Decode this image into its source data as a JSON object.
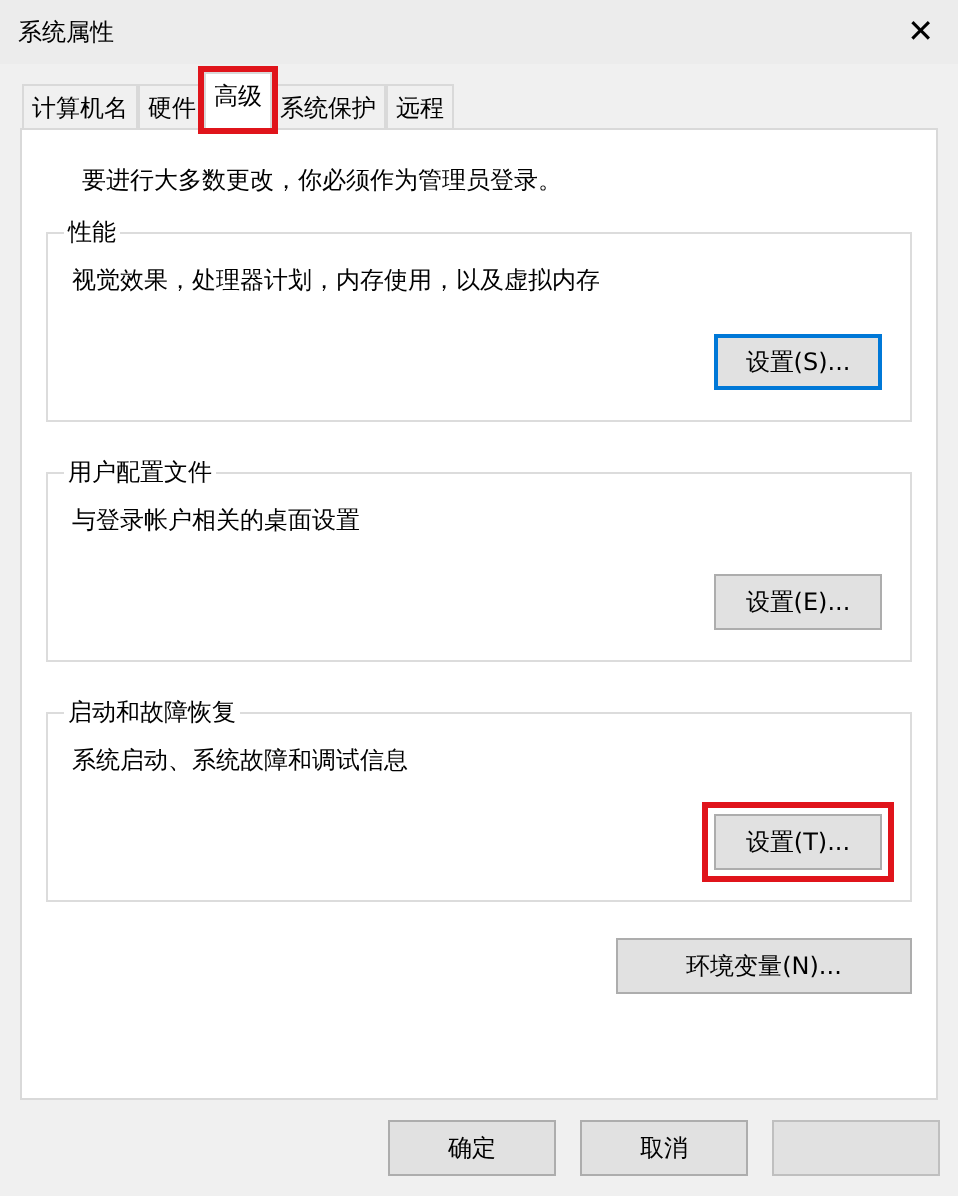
{
  "window": {
    "title": "系统属性",
    "close": "✕"
  },
  "tabs": [
    {
      "label": "计算机名",
      "selected": false,
      "highlighted": false
    },
    {
      "label": "硬件",
      "selected": false,
      "highlighted": false
    },
    {
      "label": "高级",
      "selected": true,
      "highlighted": true
    },
    {
      "label": "系统保护",
      "selected": false,
      "highlighted": false
    },
    {
      "label": "远程",
      "selected": false,
      "highlighted": false
    }
  ],
  "notice": "要进行大多数更改，你必须作为管理员登录。",
  "groups": [
    {
      "title": "性能",
      "description": "视觉效果，处理器计划，内存使用，以及虚拟内存",
      "button": "设置(S)...",
      "focused": true,
      "highlighted": false
    },
    {
      "title": "用户配置文件",
      "description": "与登录帐户相关的桌面设置",
      "button": "设置(E)...",
      "focused": false,
      "highlighted": false
    },
    {
      "title": "启动和故障恢复",
      "description": "系统启动、系统故障和调试信息",
      "button": "设置(T)...",
      "focused": false,
      "highlighted": true
    }
  ],
  "env_button": "环境变量(N)...",
  "footer_buttons": [
    "确定",
    "取消"
  ]
}
